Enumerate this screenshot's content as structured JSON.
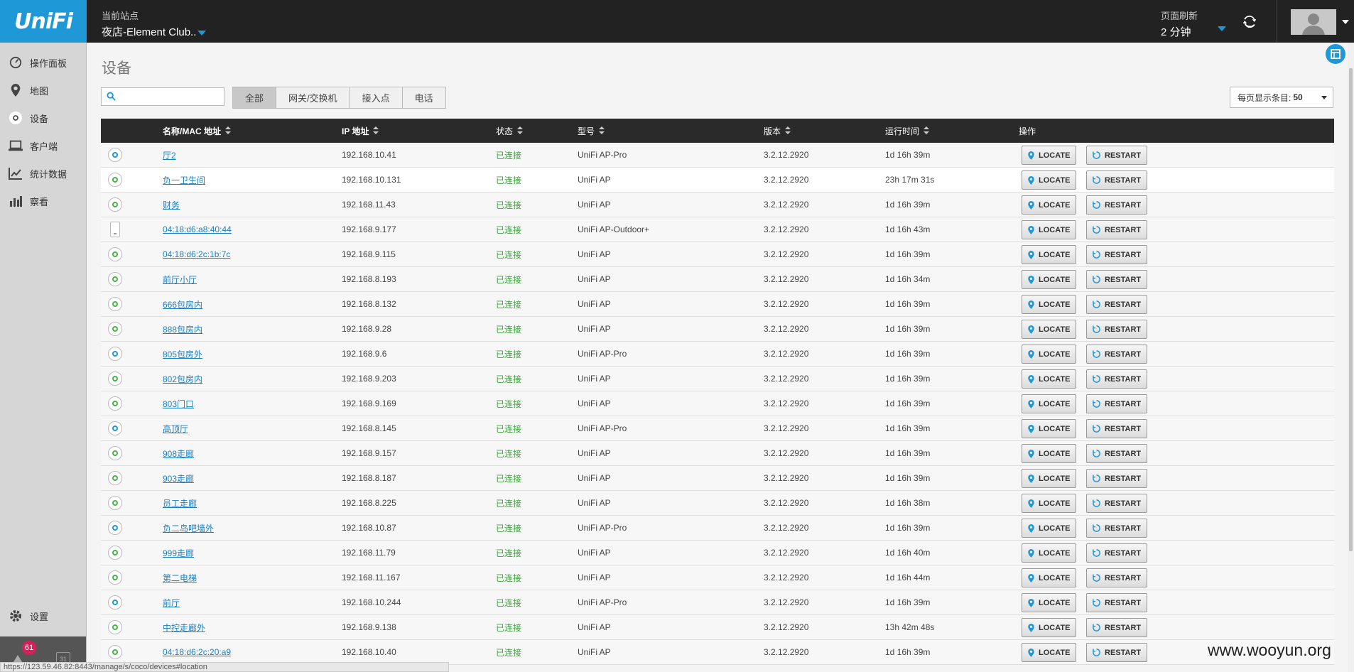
{
  "header": {
    "logo": "UniFi",
    "site_label": "当前站点",
    "site_name": "夜店-Element Club..",
    "refresh_label": "页面刷新",
    "refresh_value": "2 分钟"
  },
  "sidebar": {
    "items": [
      {
        "label": "操作面板",
        "icon": "dashboard-icon"
      },
      {
        "label": "地图",
        "icon": "map-pin-icon"
      },
      {
        "label": "设备",
        "icon": "devices-icon"
      },
      {
        "label": "客户端",
        "icon": "laptop-icon"
      },
      {
        "label": "统计数据",
        "icon": "line-chart-icon"
      },
      {
        "label": "察看",
        "icon": "bar-chart-icon"
      }
    ],
    "settings_label": "设置",
    "alert_count": "61",
    "calendar_day": "31"
  },
  "main": {
    "title": "设备",
    "search_placeholder": "",
    "filters": [
      "全部",
      "网关/交换机",
      "接入点",
      "电话"
    ],
    "perpage_label": "每页显示条目:",
    "perpage_value": "50"
  },
  "table": {
    "columns": [
      "名称/MAC 地址",
      "IP 地址",
      "状态",
      "型号",
      "版本",
      "运行时间",
      "操作"
    ],
    "locate_label": "LOCATE",
    "restart_label": "RESTART",
    "rows": [
      {
        "name": "厅2",
        "ip": "192.168.10.41",
        "status": "已连接",
        "model": "UniFi AP-Pro",
        "version": "3.2.12.2920",
        "uptime": "1d 16h 39m"
      },
      {
        "name": "负一卫生间",
        "ip": "192.168.10.131",
        "status": "已连接",
        "model": "UniFi AP",
        "version": "3.2.12.2920",
        "uptime": "23h 17m 31s"
      },
      {
        "name": "财务",
        "ip": "192.168.11.43",
        "status": "已连接",
        "model": "UniFi AP",
        "version": "3.2.12.2920",
        "uptime": "1d 16h 39m"
      },
      {
        "name": "04:18:d6:a8:40:44",
        "ip": "192.168.9.177",
        "status": "已连接",
        "model": "UniFi AP-Outdoor+",
        "version": "3.2.12.2920",
        "uptime": "1d 16h 43m"
      },
      {
        "name": "04:18:d6:2c:1b:7c",
        "ip": "192.168.9.115",
        "status": "已连接",
        "model": "UniFi AP",
        "version": "3.2.12.2920",
        "uptime": "1d 16h 39m"
      },
      {
        "name": "前厅小厅",
        "ip": "192.168.8.193",
        "status": "已连接",
        "model": "UniFi AP",
        "version": "3.2.12.2920",
        "uptime": "1d 16h 34m"
      },
      {
        "name": "666包房内",
        "ip": "192.168.8.132",
        "status": "已连接",
        "model": "UniFi AP",
        "version": "3.2.12.2920",
        "uptime": "1d 16h 39m"
      },
      {
        "name": "888包房内",
        "ip": "192.168.9.28",
        "status": "已连接",
        "model": "UniFi AP",
        "version": "3.2.12.2920",
        "uptime": "1d 16h 39m"
      },
      {
        "name": "805包房外",
        "ip": "192.168.9.6",
        "status": "已连接",
        "model": "UniFi AP-Pro",
        "version": "3.2.12.2920",
        "uptime": "1d 16h 39m"
      },
      {
        "name": "802包房内",
        "ip": "192.168.9.203",
        "status": "已连接",
        "model": "UniFi AP",
        "version": "3.2.12.2920",
        "uptime": "1d 16h 39m"
      },
      {
        "name": "803门口",
        "ip": "192.168.9.169",
        "status": "已连接",
        "model": "UniFi AP",
        "version": "3.2.12.2920",
        "uptime": "1d 16h 39m"
      },
      {
        "name": "高顶厅",
        "ip": "192.168.8.145",
        "status": "已连接",
        "model": "UniFi AP-Pro",
        "version": "3.2.12.2920",
        "uptime": "1d 16h 39m"
      },
      {
        "name": "908走廊",
        "ip": "192.168.9.157",
        "status": "已连接",
        "model": "UniFi AP",
        "version": "3.2.12.2920",
        "uptime": "1d 16h 39m"
      },
      {
        "name": "903走廊",
        "ip": "192.168.8.187",
        "status": "已连接",
        "model": "UniFi AP",
        "version": "3.2.12.2920",
        "uptime": "1d 16h 39m"
      },
      {
        "name": "员工走廊",
        "ip": "192.168.8.225",
        "status": "已连接",
        "model": "UniFi AP",
        "version": "3.2.12.2920",
        "uptime": "1d 16h 38m"
      },
      {
        "name": "负二岛吧墙外",
        "ip": "192.168.10.87",
        "status": "已连接",
        "model": "UniFi AP-Pro",
        "version": "3.2.12.2920",
        "uptime": "1d 16h 39m"
      },
      {
        "name": "999走廊",
        "ip": "192.168.11.79",
        "status": "已连接",
        "model": "UniFi AP",
        "version": "3.2.12.2920",
        "uptime": "1d 16h 40m"
      },
      {
        "name": "第二电梯",
        "ip": "192.168.11.167",
        "status": "已连接",
        "model": "UniFi AP",
        "version": "3.2.12.2920",
        "uptime": "1d 16h 44m"
      },
      {
        "name": "前厅",
        "ip": "192.168.10.244",
        "status": "已连接",
        "model": "UniFi AP-Pro",
        "version": "3.2.12.2920",
        "uptime": "1d 16h 39m"
      },
      {
        "name": "中控走廊外",
        "ip": "192.168.9.138",
        "status": "已连接",
        "model": "UniFi AP",
        "version": "3.2.12.2920",
        "uptime": "13h 42m 48s"
      },
      {
        "name": "04:18:d6:2c:20:a9",
        "ip": "192.168.10.40",
        "status": "已连接",
        "model": "UniFi AP",
        "version": "3.2.12.2920",
        "uptime": "1d 16h 39m"
      }
    ]
  },
  "statusbar": "https://123.59.46.82:8443/manage/s/coco/devices#location",
  "watermark": "www.wooyun.org"
}
